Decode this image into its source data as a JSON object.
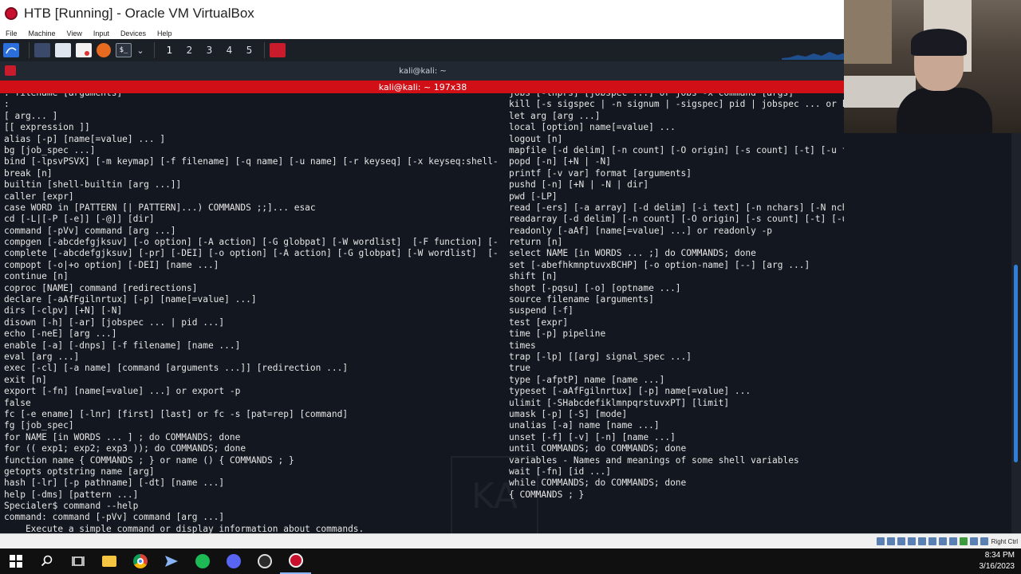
{
  "vbox": {
    "title": "HTB [Running] - Oracle VM VirtualBox",
    "menu": [
      "File",
      "Machine",
      "View",
      "Input",
      "Devices",
      "Help"
    ],
    "host_key": "Right Ctrl"
  },
  "kali_panel": {
    "workspaces": [
      "1",
      "2",
      "3",
      "4",
      "5"
    ]
  },
  "terminal": {
    "window_title": "kali@kali: ~",
    "tab_title": "kali@kali: ~ 197x38",
    "left_lines": [
      ". filename [arguments]",
      ":",
      "[ arg... ]",
      "[[ expression ]]",
      "alias [-p] [name[=value] ... ]",
      "bg [job_spec ...]",
      "bind [-lpsvPSVX] [-m keymap] [-f filename] [-q name] [-u name] [-r keyseq] [-x keyseq:shell-com>",
      "break [n]",
      "builtin [shell-builtin [arg ...]]",
      "caller [expr]",
      "case WORD in [PATTERN [| PATTERN]...) COMMANDS ;;]... esac",
      "cd [-L|[-P [-e]] [-@]] [dir]",
      "command [-pVv] command [arg ...]",
      "compgen [-abcdefgjksuv] [-o option] [-A action] [-G globpat] [-W wordlist]  [-F function] [-C c>",
      "complete [-abcdefgjksuv] [-pr] [-DEI] [-o option] [-A action] [-G globpat] [-W wordlist]  [-F f>",
      "compopt [-o|+o option] [-DEI] [name ...]",
      "continue [n]",
      "coproc [NAME] command [redirections]",
      "declare [-aAfFgilnrtux] [-p] [name[=value] ...]",
      "dirs [-clpv] [+N] [-N]",
      "disown [-h] [-ar] [jobspec ... | pid ...]",
      "echo [-neE] [arg ...]",
      "enable [-a] [-dnps] [-f filename] [name ...]",
      "eval [arg ...]",
      "exec [-cl] [-a name] [command [arguments ...]] [redirection ...]",
      "exit [n]",
      "export [-fn] [name[=value] ...] or export -p",
      "false",
      "fc [-e ename] [-lnr] [first] [last] or fc -s [pat=rep] [command]",
      "fg [job_spec]",
      "for NAME [in WORDS ... ] ; do COMMANDS; done",
      "for (( exp1; exp2; exp3 )); do COMMANDS; done",
      "function name { COMMANDS ; } or name () { COMMANDS ; }",
      "getopts optstring name [arg]",
      "hash [-lr] [-p pathname] [-dt] [name ...]",
      "help [-dms] [pattern ...]",
      "Specialer$ command --help",
      "command: command [-pVv] command [arg ...]",
      "    Execute a simple command or display information about commands."
    ],
    "right_lines": [
      "jobs [-lnprs] [jobspec ...] or jobs -x command [args]",
      "kill [-s sigspec | -n signum | -sigspec] pid | jobspec ... or kill",
      "let arg [arg ...]",
      "local [option] name[=value] ...",
      "logout [n]",
      "mapfile [-d delim] [-n count] [-O origin] [-s count] [-t] [-u fd] [-C callback] [-c quantum] [>",
      "popd [-n] [+N | -N]",
      "printf [-v var] format [arguments]",
      "pushd [-n] [+N | -N | dir]",
      "pwd [-LP]",
      "read [-ers] [-a array] [-d delim] [-i text] [-n nchars] [-N nchars] [-p prompt] [-t timeout] [>",
      "readarray [-d delim] [-n count] [-O origin] [-s count] [-t] [-u fd] [-C callback] [-c quantum]>",
      "readonly [-aAf] [name[=value] ...] or readonly -p",
      "return [n]",
      "select NAME [in WORDS ... ;] do COMMANDS; done",
      "set [-abefhkmnptuvxBCHP] [-o option-name] [--] [arg ...]",
      "shift [n]",
      "shopt [-pqsu] [-o] [optname ...]",
      "source filename [arguments]",
      "suspend [-f]",
      "test [expr]",
      "time [-p] pipeline",
      "times",
      "trap [-lp] [[arg] signal_spec ...]",
      "true",
      "type [-afptP] name [name ...]",
      "typeset [-aAfFgilnrtux] [-p] name[=value] ...",
      "ulimit [-SHabcdefiklmnpqrstuvxPT] [limit]",
      "umask [-p] [-S] [mode]",
      "unalias [-a] name [name ...]",
      "unset [-f] [-v] [-n] [name ...]",
      "until COMMANDS; do COMMANDS; done",
      "variables - Names and meanings of some shell variables",
      "wait [-fn] [id ...]",
      "while COMMANDS; do COMMANDS; done",
      "{ COMMANDS ; }"
    ],
    "watermark": "KA"
  },
  "taskbar": {
    "time": "8:34 PM",
    "date": "3/16/2023"
  },
  "colors": {
    "terminal_bg": "#131820",
    "tab_red": "#d00f17",
    "scroll_thumb": "#2f7fd8"
  }
}
